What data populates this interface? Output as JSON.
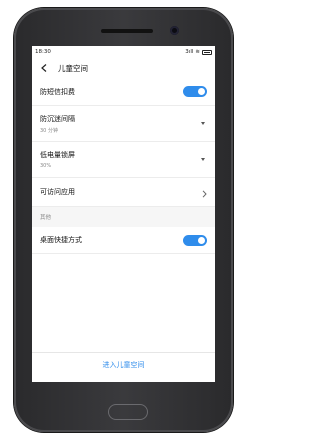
{
  "status": {
    "time": "18:30",
    "signal": "3ıll",
    "wifi": "≋"
  },
  "header": {
    "title": "儿童空间"
  },
  "settings": {
    "sms_block": {
      "label": "防短信扣费",
      "enabled": true
    },
    "addiction": {
      "label": "防沉迷间隔",
      "value": "30 分钟"
    },
    "low_battery": {
      "label": "低电量锁屏",
      "value": "30%"
    },
    "apps": {
      "label": "可访问应用"
    },
    "section_other": "其他",
    "shortcut": {
      "label": "桌面快捷方式",
      "enabled": true
    }
  },
  "footer": {
    "enter_label": "进入儿童空间"
  },
  "colors": {
    "accent": "#2f8ceb",
    "phone_body": "#333335"
  }
}
